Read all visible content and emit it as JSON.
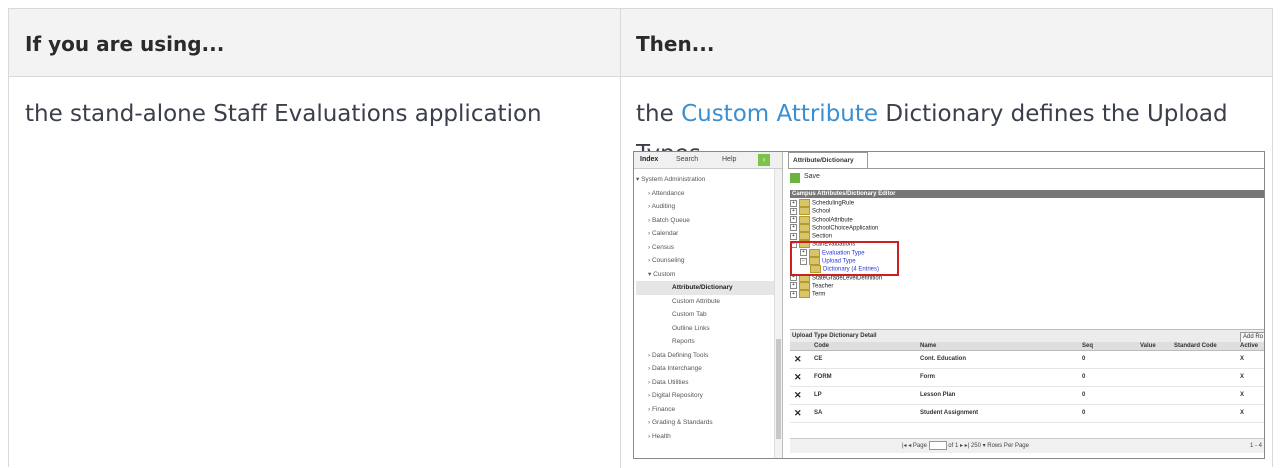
{
  "table": {
    "headers": [
      "If you are using...",
      "Then..."
    ],
    "row": {
      "left_text": "the stand-alone Staff Evaluations application",
      "right_link": "Custom Attribute",
      "right_pre": "the ",
      "right_post": " Dictionary defines the Upload Types."
    }
  },
  "screenshot": {
    "left_tabs": [
      "Index",
      "Search",
      "Help"
    ],
    "collapse_glyph": "‹",
    "nav": [
      {
        "label": "▾ System Administration",
        "level": 1
      },
      {
        "label": "› Attendance",
        "level": 2
      },
      {
        "label": "› Auditing",
        "level": 2
      },
      {
        "label": "› Batch Queue",
        "level": 2
      },
      {
        "label": "› Calendar",
        "level": 2
      },
      {
        "label": "› Census",
        "level": 2
      },
      {
        "label": "› Counseling",
        "level": 2
      },
      {
        "label": "▾ Custom",
        "level": 2
      },
      {
        "label": "Attribute/Dictionary",
        "level": 3,
        "selected": true
      },
      {
        "label": "Custom Attribute",
        "level": 3
      },
      {
        "label": "Custom Tab",
        "level": 3
      },
      {
        "label": "Outline Links",
        "level": 3
      },
      {
        "label": "Reports",
        "level": 3
      },
      {
        "label": "› Data Defining Tools",
        "level": 2
      },
      {
        "label": "› Data Interchange",
        "level": 2
      },
      {
        "label": "› Data Utilities",
        "level": 2
      },
      {
        "label": "› Digital Repository",
        "level": 2
      },
      {
        "label": "› Finance",
        "level": 2
      },
      {
        "label": "› Grading & Standards",
        "level": 2
      },
      {
        "label": "› Health",
        "level": 2
      }
    ],
    "right_tab": "Attribute/Dictionary",
    "save_label": "Save",
    "editor_title": "Campus Attributes/Dictionary Editor",
    "tree": [
      {
        "label": "SchedulingRule",
        "indent": 0
      },
      {
        "label": "School",
        "indent": 0
      },
      {
        "label": "SchoolAttribute",
        "indent": 0
      },
      {
        "label": "SchoolChoiceApplication",
        "indent": 0
      },
      {
        "label": "Section",
        "indent": 0
      },
      {
        "label": "StaffEvaluations",
        "indent": 0,
        "open": true
      },
      {
        "label": "Evaluation Type",
        "indent": 1,
        "blue": true
      },
      {
        "label": "Upload Type",
        "indent": 1,
        "blue": true,
        "open": true
      },
      {
        "label": "Dictionary (4 Entries)",
        "indent": 2,
        "blue": true
      },
      {
        "label": "StateGradeLevelDefinition",
        "indent": 0
      },
      {
        "label": "Teacher",
        "indent": 0
      },
      {
        "label": "Term",
        "indent": 0
      }
    ],
    "detail_title": "Upload Type Dictionary Detail",
    "add_label": "Add Ro",
    "grid_headers": {
      "code": "Code",
      "name": "Name",
      "seq": "Seq",
      "value": "Value",
      "std": "Standard Code",
      "active": "Active"
    },
    "grid_rows": [
      {
        "code": "CE",
        "name": "Cont. Education",
        "seq": "0",
        "active": "X"
      },
      {
        "code": "FORM",
        "name": "Form",
        "seq": "0",
        "active": "X"
      },
      {
        "code": "LP",
        "name": "Lesson Plan",
        "seq": "0",
        "active": "X"
      },
      {
        "code": "SA",
        "name": "Student Assignment",
        "seq": "0",
        "active": "X"
      }
    ],
    "pager_left": "Page",
    "pager_page": "1",
    "pager_of": "of 1",
    "pager_rows": "250",
    "pager_rows_label": "Rows Per Page",
    "pager_right": "1 - 4"
  }
}
